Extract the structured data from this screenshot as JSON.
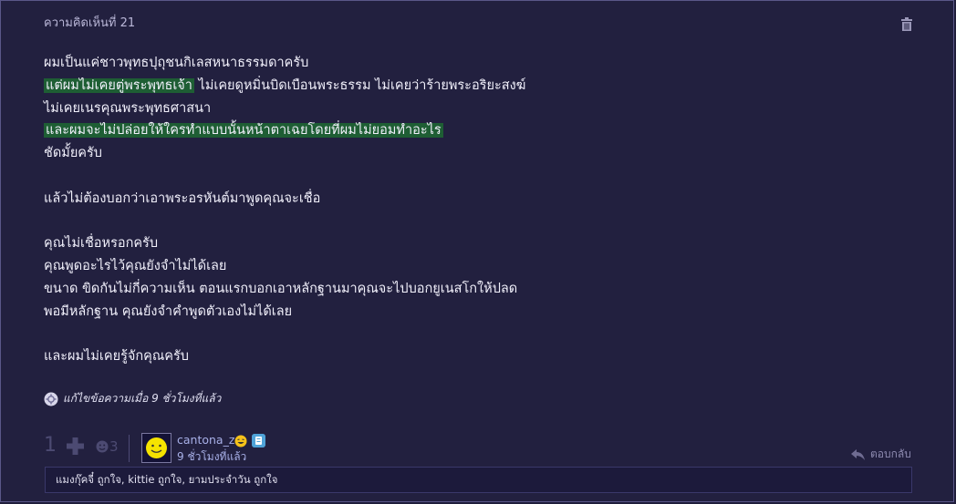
{
  "comment": {
    "number_label": "ความคิดเห็นที่ 21",
    "lines": [
      "ผมเป็นแค่ชาวพุทธปุถุชนกิเลสหนาธรรมดาครับ",
      "แต่ผมไม่เคยตู่พระพุทธเจ้า",
      "ไม่เคยดูหมิ่นบิดเบือนพระธรรม ไม่เคยว่าร้ายพระอริยะสงฆ์",
      "ไม่เคยเนรคุณพระพุทธศาสนา",
      "และผมจะไม่ปล่อยให้ใครทำแบบนั้นหน้าตาเฉยโดยที่ผมไม่ยอมทำอะไร",
      "ชัดมั้ยครับ",
      "แล้วไม่ต้องบอกว่าเอาพระอรหันต์มาพูดคุณจะเชื่อ",
      "คุณไม่เชื่อหรอกครับ",
      "คุณพูดอะไรไว้คุณยังจำไม่ได้เลย",
      "ขนาด ขิดกันไม่กี่ความเห็น ตอนแรกบอกเอาหลักฐานมาคุณจะไปบอกยูเนสโกให้ปลด",
      "พอมีหลักฐาน คุณยังจำคำพูดตัวเองไม่ได้เลย",
      "และผมไม่เคยรู้จักคุณครับ"
    ],
    "edited_label": "แก้ไขข้อความเมื่อ 9 ชั่วโมงที่แล้ว",
    "vote_count": "1",
    "emotion_count": "3",
    "author": {
      "name": "cantona_z",
      "time": "9 ชั่วโมงที่แล้ว"
    },
    "reply_label": "ตอบกลับ",
    "likes_text": "แมงกุ๊คจี๋ ถูกใจ, kittie ถูกใจ, ยามประจำวัน ถูกใจ"
  },
  "colors": {
    "background": "#22203f",
    "highlight": "#1e5e34",
    "link": "#a8b0e8"
  },
  "icons": [
    "trash-icon",
    "plus-icon",
    "emotion-icon",
    "edited-badge-icon",
    "reply-icon",
    "smiley-avatar-icon"
  ]
}
